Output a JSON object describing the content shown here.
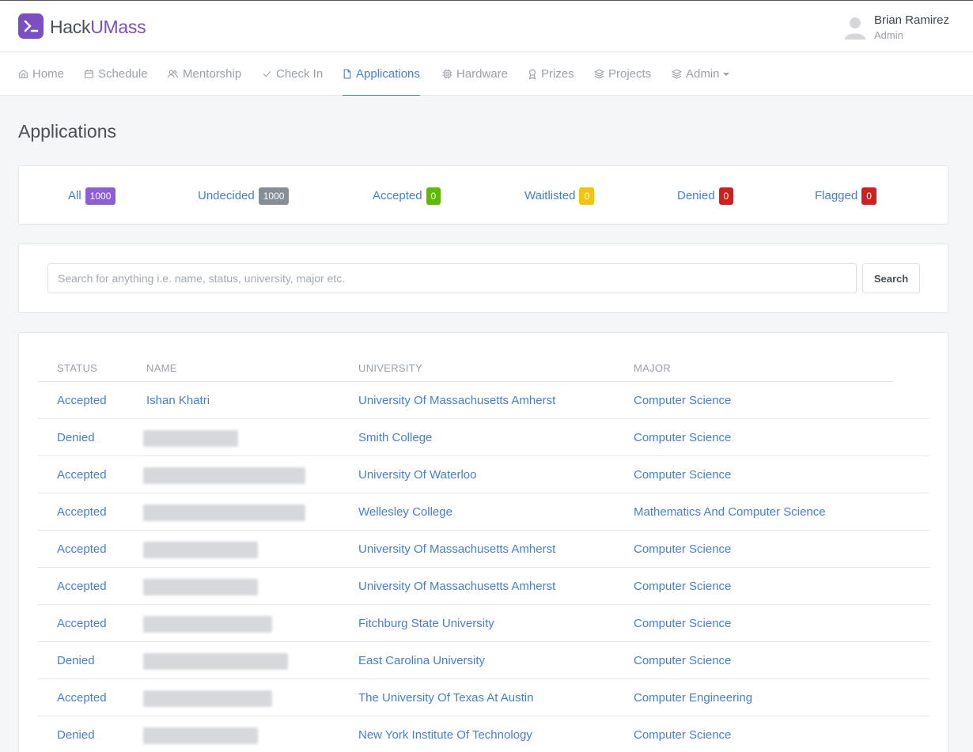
{
  "header": {
    "logo_text_a": "Hack",
    "logo_text_b": "UMass",
    "user_name": "Brian Ramirez",
    "user_role": "Admin"
  },
  "nav": [
    {
      "label": "Home",
      "icon": "home-icon"
    },
    {
      "label": "Schedule",
      "icon": "calendar-icon"
    },
    {
      "label": "Mentorship",
      "icon": "users-icon"
    },
    {
      "label": "Check In",
      "icon": "check-icon"
    },
    {
      "label": "Applications",
      "icon": "file-icon",
      "active": true
    },
    {
      "label": "Hardware",
      "icon": "cpu-icon"
    },
    {
      "label": "Prizes",
      "icon": "award-icon"
    },
    {
      "label": "Projects",
      "icon": "layers-icon"
    },
    {
      "label": "Admin",
      "icon": "layers-icon"
    }
  ],
  "page_title": "Applications",
  "filters": [
    {
      "label": "All",
      "count": "1000",
      "color": "#8b5fd6"
    },
    {
      "label": "Undecided",
      "count": "1000",
      "color": "#868e96"
    },
    {
      "label": "Accepted",
      "count": "0",
      "color": "#5eba00"
    },
    {
      "label": "Waitlisted",
      "count": "0",
      "color": "#f1c40f"
    },
    {
      "label": "Denied",
      "count": "0",
      "color": "#cd201f"
    },
    {
      "label": "Flagged",
      "count": "0",
      "color": "#cd201f"
    }
  ],
  "search": {
    "placeholder": "Search for anything i.e. name, status, university, major etc.",
    "button_label": "Search"
  },
  "table": {
    "headers": [
      "STATUS",
      "NAME",
      "UNIVERSITY",
      "MAJOR"
    ],
    "rows": [
      {
        "status": "Accepted",
        "name": "Ishan Khatri",
        "university": "University Of Massachusetts Amherst",
        "major": "Computer Science"
      },
      {
        "status": "Denied",
        "name": "",
        "university": "Smith College",
        "major": "Computer Science"
      },
      {
        "status": "Accepted",
        "name": "",
        "university": "University Of Waterloo",
        "major": "Computer Science"
      },
      {
        "status": "Accepted",
        "name": "",
        "university": "Wellesley College",
        "major": "Mathematics And Computer Science"
      },
      {
        "status": "Accepted",
        "name": "",
        "university": "University Of Massachusetts Amherst",
        "major": "Computer Science"
      },
      {
        "status": "Accepted",
        "name": "",
        "university": "University Of Massachusetts Amherst",
        "major": "Computer Science"
      },
      {
        "status": "Accepted",
        "name": "",
        "university": "Fitchburg State University",
        "major": "Computer Science"
      },
      {
        "status": "Denied",
        "name": "",
        "university": "East Carolina University",
        "major": "Computer Science"
      },
      {
        "status": "Accepted",
        "name": "",
        "university": "The University Of Texas At Austin",
        "major": "Computer Engineering"
      },
      {
        "status": "Denied",
        "name": "",
        "university": "New York Institute Of Technology",
        "major": "Computer Science"
      }
    ]
  }
}
